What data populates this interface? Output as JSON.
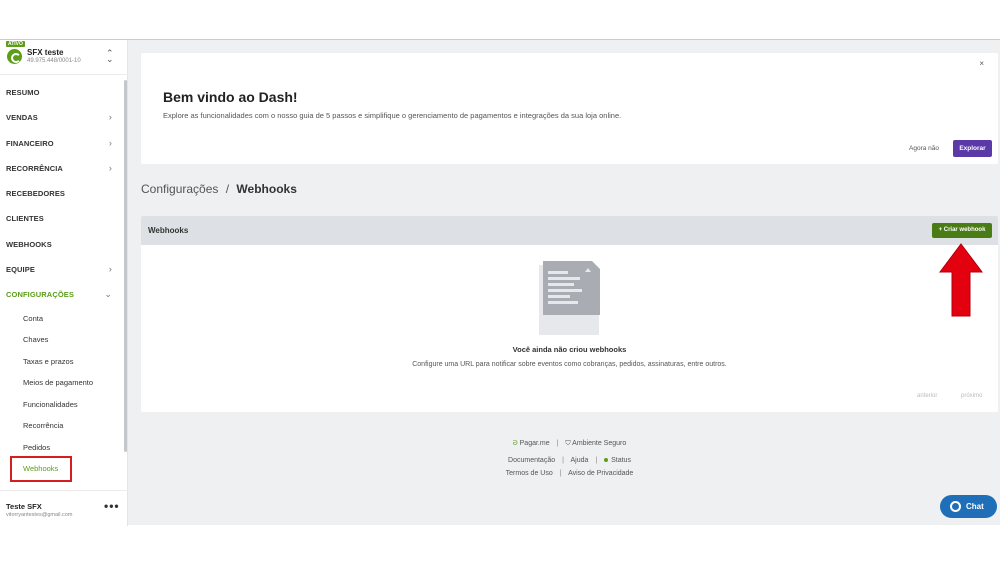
{
  "account": {
    "badge": "ATIVO",
    "name": "SFX teste",
    "document": "49.975.448/0001-10",
    "switch_icon": "unfold-icon"
  },
  "nav": [
    {
      "label": "RESUMO",
      "has_chevron": false
    },
    {
      "label": "VENDAS",
      "has_chevron": true
    },
    {
      "label": "FINANCEIRO",
      "has_chevron": true
    },
    {
      "label": "RECORRÊNCIA",
      "has_chevron": true
    },
    {
      "label": "RECEBEDORES",
      "has_chevron": false
    },
    {
      "label": "CLIENTES",
      "has_chevron": false
    },
    {
      "label": "WEBHOOKS",
      "has_chevron": false
    },
    {
      "label": "EQUIPE",
      "has_chevron": true
    },
    {
      "label": "CONFIGURAÇÕES",
      "has_chevron": true,
      "active": true
    }
  ],
  "chevron": "›",
  "chevron_down": "⌄",
  "subnav": [
    "Conta",
    "Chaves",
    "Taxas e prazos",
    "Meios de pagamento",
    "Funcionalidades",
    "Recorrência",
    "Pedidos",
    "Webhooks"
  ],
  "user": {
    "name": "Teste SFX",
    "email": "vitorryantestes@gmail.com",
    "more": "•••"
  },
  "welcome": {
    "close": "×",
    "title": "Bem vindo ao Dash!",
    "subtitle": "Explore as funcionalidades com o nosso guia de 5 passos e simplifique o gerenciamento de pagamentos e integrações da sua loja online.",
    "later": "Agora não",
    "explore": "Explorar"
  },
  "breadcrumb": {
    "parent": "Configurações",
    "separator": "/",
    "current": "Webhooks"
  },
  "webhooks": {
    "title": "Webhooks",
    "create": "+ Criar webhook",
    "empty_title": "Você ainda não criou webhooks",
    "empty_subtitle": "Configure uma URL para notificar sobre eventos como cobranças, pedidos, assinaturas, entre outros.",
    "prev": "anterior",
    "next": "próximo"
  },
  "footer": {
    "brand": "Pagar.me",
    "secure": "Ambiente Seguro",
    "docs": "Documentação",
    "help": "Ajuda",
    "status": "Status",
    "terms": "Termos de Uso",
    "privacy": "Aviso de Privacidade"
  },
  "chat": {
    "label": "Chat"
  },
  "colors": {
    "accent": "#5c9e1a",
    "primary_button": "#5b3aa8",
    "create_button": "#4a7c16",
    "highlight": "#d31f1f",
    "chat": "#1f6fb8"
  }
}
